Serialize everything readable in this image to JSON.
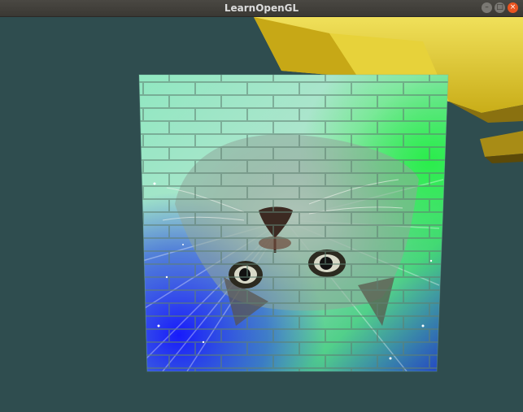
{
  "window": {
    "title": "LearnOpenGL",
    "controls": {
      "minimize": "–",
      "maximize": "□",
      "close": "×"
    }
  },
  "scene": {
    "clear_color": "#2f4d4f",
    "cube_texture": "container-cat-glow",
    "background_object_color": "#d9c21e"
  }
}
